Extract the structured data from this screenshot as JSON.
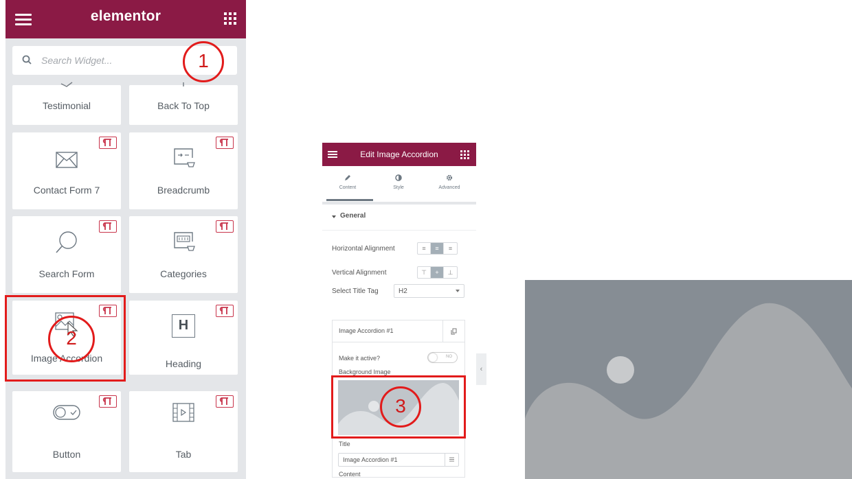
{
  "left_panel": {
    "brand": "elementor",
    "search_placeholder": "Search Widget...",
    "widgets": [
      {
        "label": "Testimonial",
        "icon": "testimonial-icon",
        "pro": false
      },
      {
        "label": "Back To Top",
        "icon": "back-to-top-icon",
        "pro": false
      },
      {
        "label": "Contact Form 7",
        "icon": "envelope-icon",
        "pro": true
      },
      {
        "label": "Breadcrumb",
        "icon": "breadcrumb-icon",
        "pro": true
      },
      {
        "label": "Search Form",
        "icon": "search-icon",
        "pro": true
      },
      {
        "label": "Categories",
        "icon": "categories-icon",
        "pro": true
      },
      {
        "label": "Image Accordion",
        "icon": "image-accordion-icon",
        "pro": true
      },
      {
        "label": "Heading",
        "icon": "heading-icon",
        "pro": true
      },
      {
        "label": "Button",
        "icon": "toggle-button-icon",
        "pro": true
      },
      {
        "label": "Tab",
        "icon": "tab-icon",
        "pro": true
      }
    ],
    "heading_icon_letter": "H"
  },
  "edit_panel": {
    "title": "Edit Image Accordion",
    "tabs": [
      {
        "label": "Content",
        "icon": "pencil-icon",
        "active": true
      },
      {
        "label": "Style",
        "icon": "half-circle-icon",
        "active": false
      },
      {
        "label": "Advanced",
        "icon": "gear-icon",
        "active": false
      }
    ],
    "section_title": "General",
    "horizontal_alignment_label": "Horizontal Alignment",
    "vertical_alignment_label": "Vertical Alignment",
    "select_title_tag_label": "Select Title Tag",
    "select_title_tag_value": "H2",
    "repeater_item_title": "Image Accordion #1",
    "make_active_label": "Make it active?",
    "make_active_toggle": "NO",
    "background_image_label": "Background Image",
    "title_label": "Title",
    "title_value": "Image Accordion #1",
    "content_label": "Content",
    "collapse_arrow": "‹"
  },
  "annotations": [
    "1",
    "2",
    "3"
  ],
  "colors": {
    "brand": "#8b1a45",
    "annotation_red": "#e21b1b",
    "panel_bg": "#e4e6e9",
    "placeholder_bg": "#868d94",
    "placeholder_shape": "#a6a9ac",
    "placeholder_sun": "#c8cacc"
  }
}
